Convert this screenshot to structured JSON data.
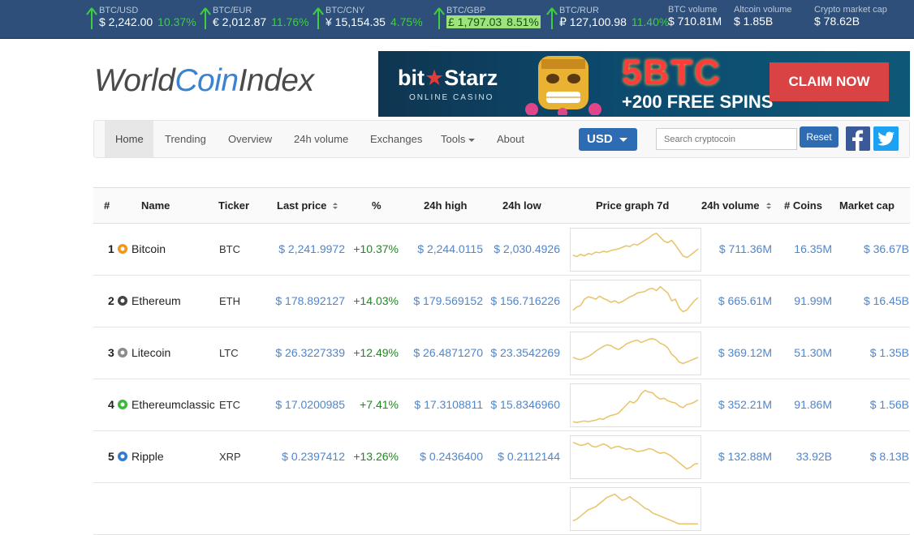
{
  "ticker": [
    {
      "label": "BTC/USD",
      "value": "$ 2,242.00",
      "pct": "10.37%",
      "highlight": false
    },
    {
      "label": "BTC/EUR",
      "value": "€ 2,012.87",
      "pct": "11.76%",
      "highlight": false
    },
    {
      "label": "BTC/CNY",
      "value": "¥ 15,154.35",
      "pct": "4.75%",
      "highlight": false
    },
    {
      "label": "BTC/GBP",
      "value": "£ 1,797.03",
      "pct": "8.51%",
      "highlight": true
    },
    {
      "label": "BTC/RUR",
      "value": "₽ 127,100.98",
      "pct": "11.40%",
      "highlight": false
    }
  ],
  "stats": [
    {
      "label": "BTC volume",
      "value": "$ 710.81M"
    },
    {
      "label": "Altcoin volume",
      "value": "$ 1.85B"
    },
    {
      "label": "Crypto market cap",
      "value": "$ 78.62B"
    }
  ],
  "logo": {
    "part1": "World",
    "part2": "Coin",
    "part3": "Index"
  },
  "banner": {
    "brand_a": "bit",
    "brand_b": "Starz",
    "sub": "ONLINE CASINO",
    "offer1": "5BTC",
    "offer2": "+200 FREE SPINS",
    "cta": "CLAIM NOW"
  },
  "nav": {
    "items": [
      "Home",
      "Trending",
      "Overview",
      "24h volume",
      "Exchanges",
      "Tools",
      "About"
    ],
    "currency": "USD",
    "search_placeholder": "Search cryptocoin",
    "reset": "Reset"
  },
  "table": {
    "headers": {
      "rank": "#",
      "name": "Name",
      "ticker": "Ticker",
      "last": "Last price",
      "pct": "%",
      "high": "24h high",
      "low": "24h low",
      "graph": "Price graph 7d",
      "volume": "24h volume",
      "coins": "# Coins",
      "cap": "Market cap"
    },
    "rows": [
      {
        "rank": "1",
        "name": "Bitcoin",
        "ticker": "BTC",
        "last": "$ 2,241.9972",
        "pct": "+10.37%",
        "high": "$ 2,244.0115",
        "low": "$ 2,030.4926",
        "volume": "$ 711.36M",
        "coins": "16.35M",
        "cap": "$ 36.67B",
        "icon": "bitcoin-icon",
        "color": "#f7931a",
        "spark": [
          32,
          34,
          31,
          33,
          30,
          31,
          28,
          29,
          27,
          28,
          26,
          25,
          24,
          22,
          20,
          21,
          18,
          19,
          16,
          13,
          10,
          6,
          4,
          9,
          14,
          16,
          13,
          19,
          26,
          33,
          35,
          32,
          28,
          24
        ]
      },
      {
        "rank": "2",
        "name": "Ethereum",
        "ticker": "ETH",
        "last": "$ 178.892127",
        "pct": "+14.03%",
        "high": "$ 179.569152",
        "low": "$ 156.716226",
        "volume": "$ 665.61M",
        "coins": "91.99M",
        "cap": "$ 16.45B",
        "icon": "ethereum-icon",
        "color": "#444444",
        "spark": [
          36,
          32,
          30,
          22,
          19,
          20,
          22,
          18,
          21,
          23,
          26,
          24,
          27,
          25,
          22,
          19,
          17,
          14,
          13,
          12,
          9,
          8,
          11,
          6,
          10,
          14,
          24,
          22,
          33,
          38,
          36,
          30,
          24,
          20
        ]
      },
      {
        "rank": "3",
        "name": "Litecoin",
        "ticker": "LTC",
        "last": "$ 26.3227339",
        "pct": "+12.49%",
        "high": "$ 26.4871270",
        "low": "$ 23.3542269",
        "volume": "$ 369.12M",
        "coins": "51.30M",
        "cap": "$ 1.35B",
        "icon": "litecoin-icon",
        "color": "#8b8b8b",
        "spark": [
          30,
          32,
          33,
          31,
          29,
          26,
          22,
          19,
          16,
          14,
          15,
          18,
          20,
          17,
          13,
          11,
          9,
          8,
          11,
          9,
          7,
          6,
          8,
          12,
          14,
          18,
          26,
          30,
          36,
          38,
          36,
          34,
          32,
          30
        ]
      },
      {
        "rank": "4",
        "name": "Ethereumclassic",
        "ticker": "ETC",
        "last": "$ 17.0200985",
        "pct": "+7.41%",
        "high": "$ 17.3108811",
        "low": "$ 15.8346960",
        "volume": "$ 352.21M",
        "coins": "91.86M",
        "cap": "$ 1.56B",
        "icon": "ethereumclassic-icon",
        "color": "#3ab83a",
        "spark": [
          46,
          47,
          46,
          45,
          46,
          45,
          44,
          42,
          43,
          40,
          38,
          37,
          35,
          30,
          25,
          20,
          22,
          18,
          10,
          6,
          8,
          9,
          14,
          17,
          16,
          19,
          21,
          22,
          26,
          28,
          24,
          23,
          21,
          18
        ]
      },
      {
        "rank": "5",
        "name": "Ripple",
        "ticker": "XRP",
        "last": "$ 0.2397412",
        "pct": "+13.26%",
        "high": "$ 0.2436400",
        "low": "$ 0.2112144",
        "volume": "$ 132.88M",
        "coins": "33.92B",
        "cap": "$ 8.13B",
        "icon": "ripple-icon",
        "color": "#2e7ad6",
        "spark": [
          6,
          8,
          10,
          9,
          7,
          11,
          12,
          10,
          8,
          10,
          14,
          12,
          11,
          13,
          15,
          14,
          16,
          18,
          17,
          16,
          14,
          15,
          18,
          20,
          19,
          21,
          24,
          28,
          32,
          36,
          40,
          38,
          34,
          33
        ]
      },
      {
        "rank": "",
        "name": "",
        "ticker": "",
        "last": "",
        "pct": "",
        "high": "",
        "low": "",
        "volume": "",
        "coins": "",
        "cap": "",
        "icon": "",
        "color": "#cccccc",
        "spark": [
          40,
          38,
          34,
          30,
          26,
          24,
          22,
          18,
          14,
          10,
          8,
          6,
          10,
          14,
          12,
          9,
          13,
          16,
          20,
          24,
          26,
          30,
          32,
          34,
          36,
          38,
          40,
          42,
          44,
          44,
          44,
          44,
          44,
          44
        ]
      }
    ]
  }
}
